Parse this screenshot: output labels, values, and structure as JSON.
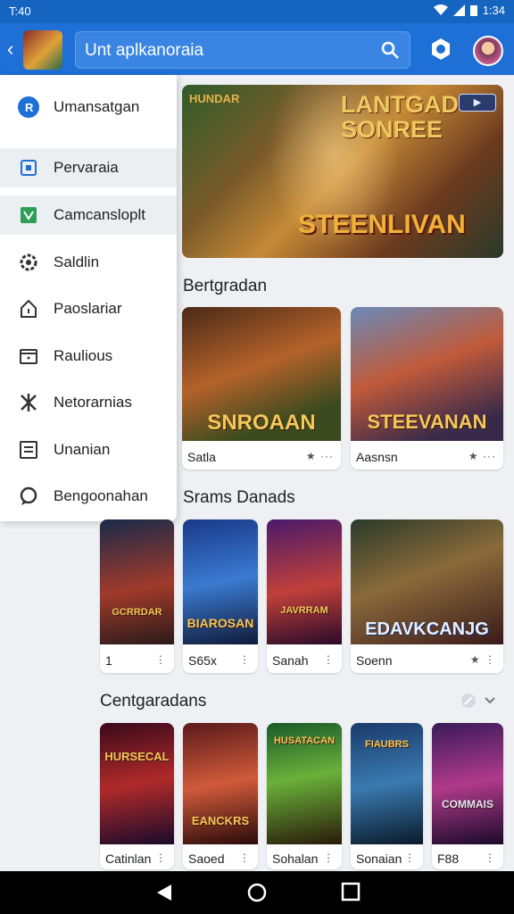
{
  "status": {
    "time": "T:40",
    "battery": "1:34"
  },
  "appbar": {
    "search_text": "Unt aplkanoraia"
  },
  "drawer": {
    "header": "Umansatgan",
    "items": [
      {
        "label": "Pervaraia",
        "icon": "calendar-icon"
      },
      {
        "label": "Camcansloplt",
        "icon": "image-icon"
      },
      {
        "label": "Saldlin",
        "icon": "gear-icon"
      },
      {
        "label": "Paoslariar",
        "icon": "home-icon"
      },
      {
        "label": "Raulious",
        "icon": "folder-icon"
      },
      {
        "label": "Netorarnias",
        "icon": "puzzle-icon"
      },
      {
        "label": "Unanian",
        "icon": "list-icon"
      },
      {
        "label": "Bengoonahan",
        "icon": "chat-icon"
      }
    ]
  },
  "hero": {
    "title_top_left": "HUNDAR",
    "title_top_right": "LANTGAD SONREE",
    "title_main": "STEENLIVAN"
  },
  "section1": {
    "title": "Bertgradan",
    "cards": [
      {
        "art_title": "SNROAAN",
        "name": "Satla",
        "meta": "★ ···"
      },
      {
        "art_title": "STEEVANAN",
        "name": "Aasnsn",
        "meta": "★ ···"
      }
    ]
  },
  "section2": {
    "title": "Srams Danads",
    "cards": [
      {
        "art_title": "GCRRDAR",
        "name": "1",
        "meta": "⋮"
      },
      {
        "art_title": "BIAROSAN",
        "name": "S65x",
        "meta": "⋮"
      },
      {
        "art_title": "JAVRRAM",
        "name": "Sanah",
        "meta": "⋮"
      },
      {
        "art_title": "EDAVKCANJG",
        "name": "Soenn",
        "meta": "★ ⋮"
      }
    ]
  },
  "section3": {
    "title": "Centgaradans",
    "cards": [
      {
        "art_title": "HURSECAL",
        "name": "Catinlan",
        "meta": "⋮"
      },
      {
        "art_title": "EANCKRS",
        "name": "Saoed",
        "meta": "⋮"
      },
      {
        "art_title": "HUSATACAN",
        "name": "Sohalan",
        "meta": "⋮"
      },
      {
        "art_title": "FIAUBRS",
        "name": "Sonaian",
        "meta": "⋮"
      },
      {
        "art_title": "COMMAIS",
        "name": "F88",
        "meta": "⋮"
      }
    ]
  },
  "colors": {
    "appbar": "#1e6fd6",
    "statusbar": "#1565c0",
    "accent": "#f5c85a"
  }
}
